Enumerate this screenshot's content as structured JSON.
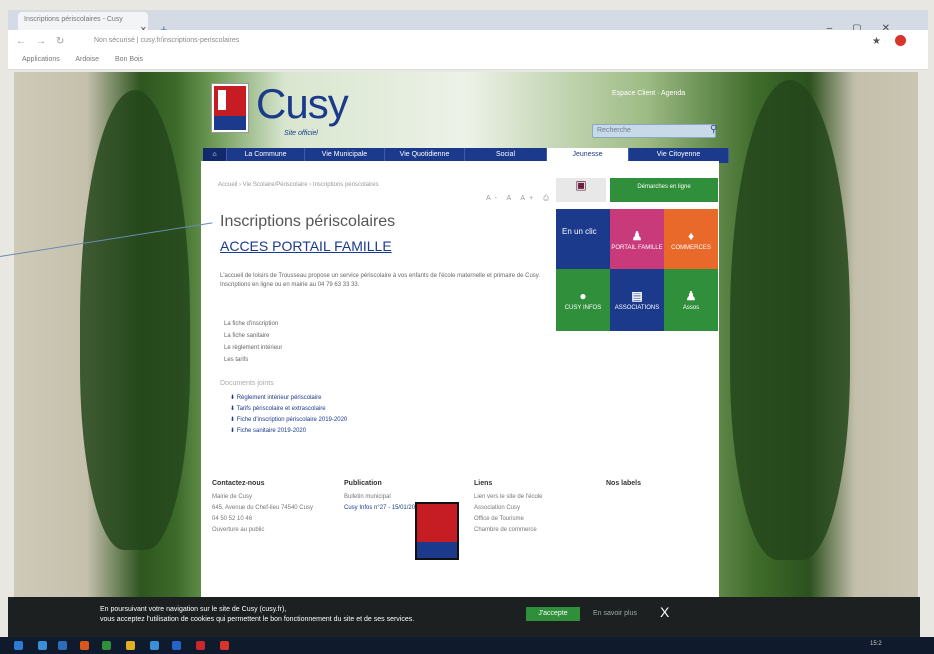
{
  "browser": {
    "tab_title": "Inscriptions périscolaires - Cusy",
    "url": "Non sécurisé | cusy.fr/inscriptions-periscolaires",
    "bookmarks": [
      "Applications",
      "Ardoise",
      "Bon Bois"
    ]
  },
  "site": {
    "brand": "Cusy",
    "brand_sub": "Site officiel",
    "account": "Espace Client · Agenda",
    "search_placeholder": "Recherche",
    "menu": [
      "La Commune",
      "Vie Municipale",
      "Vie Quotidienne",
      "Social",
      "Jeunesse",
      "Vie Citoyenne"
    ],
    "breadcrumb": "Accueil › Vie Scolaire/Périscolaire › Inscriptions périscolaires"
  },
  "content": {
    "title": "Inscriptions périscolaires",
    "subtitle": "ACCES PORTAIL FAMILLE",
    "para": "L'accueil de loisirs de Trousseau propose un service périscolaire à vos enfants de l'école maternelle et primaire de Cusy. Inscriptions en ligne ou en mairie au 04 79 63 33 33.",
    "list": [
      "La fiche d'inscription",
      "La fiche sanitaire",
      "Le règlement intérieur",
      "Les tarifs"
    ],
    "docs_title": "Documents joints",
    "docs": [
      "Règlement intérieur périscolaire",
      "Tarifs périscolaire et extrascolaire",
      "Fiche d'inscription périscolaire 2019-2020",
      "Fiche sanitaire 2019-2020"
    ]
  },
  "tiles": {
    "demarches": "Démarches en ligne",
    "en_un_clic": "En un clic",
    "portail": "PORTAIL FAMILLE",
    "commerces": "COMMERCES",
    "cusy_infos": "CUSY INFOS",
    "associations": "ASSOCIATIONS",
    "assos": "Assos"
  },
  "footer": {
    "contact_title": "Contactez-nous",
    "contact": [
      "Mairie de Cusy",
      "645, Avenue du Chef-lieu 74540 Cusy",
      "04 50 52 10 46",
      "Ouverture au public"
    ],
    "pub_title": "Publication",
    "pub": [
      "Bulletin municipal",
      "Cusy Infos n°27 - 15/01/2019"
    ],
    "liens_title": "Liens",
    "liens": [
      "Lien vers le site de l'école",
      "Association Cusy",
      "Office de Tourisme",
      "Chambre de commerce"
    ],
    "labels_title": "Nos labels"
  },
  "cookie": {
    "msg1": "En poursuivant votre navigation sur le site de Cusy (cusy.fr),",
    "msg2": "vous acceptez l'utilisation de cookies qui permettent le bon fonctionnement du site et de ses services.",
    "accept": "J'accepte",
    "more": "En savoir plus",
    "close": "X"
  },
  "taskbar": {
    "clock": "15:2"
  }
}
